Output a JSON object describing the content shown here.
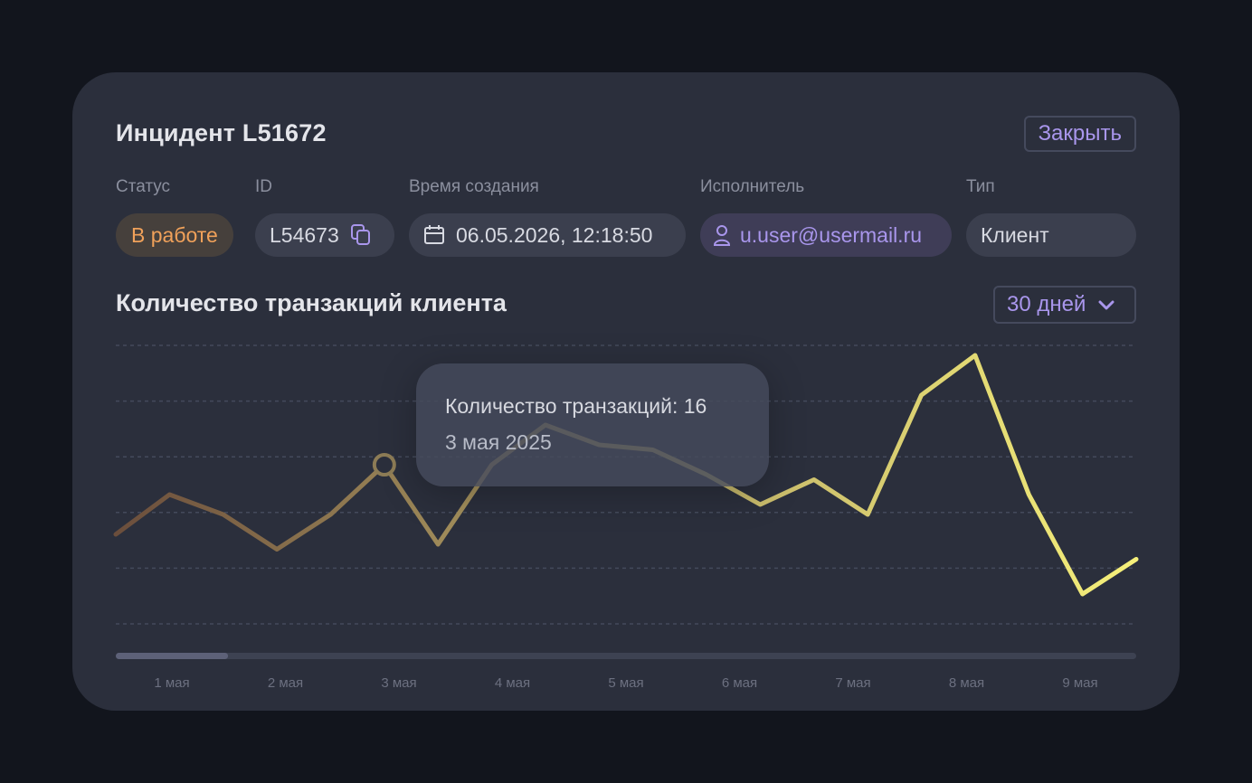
{
  "incident": {
    "title": "Инцидент L51672",
    "close_label": "Закрыть"
  },
  "fields": {
    "status": {
      "label": "Статус",
      "value": "В работе"
    },
    "id": {
      "label": "ID",
      "value": "L54673",
      "icon": "copy-icon"
    },
    "created": {
      "label": "Время создания",
      "value": "06.05.2026, 12:18:50",
      "icon": "calendar-icon"
    },
    "assignee": {
      "label": "Исполнитель",
      "value": "u.user@usermail.ru",
      "icon": "user-icon"
    },
    "type": {
      "label": "Тип",
      "value": "Клиент"
    }
  },
  "colors": {
    "accent": "#a996ec",
    "status_orange": "#f0a15a",
    "line_start": "#6b4e3c",
    "line_end": "#f6f07a"
  },
  "chart_section": {
    "title": "Количество транзакций клиента",
    "range_value": "30 дней",
    "range_icon": "chevron-down-icon"
  },
  "tooltip": {
    "line1": "Количество транзакций: 16",
    "line2": "3 мая 2025"
  },
  "scrollbar": {
    "visible_fraction": 0.11
  },
  "chart_data": {
    "type": "line",
    "x_labels": [
      "1 мая",
      "2 мая",
      "3 мая",
      "4 мая",
      "5 мая",
      "6 мая",
      "7 мая",
      "8 мая",
      "9 мая"
    ],
    "values": [
      9,
      13,
      11,
      7.5,
      11,
      16,
      8,
      16,
      20,
      18,
      17.5,
      15,
      12,
      14.5,
      11,
      23,
      27,
      13,
      3,
      6.5
    ],
    "ylim": [
      0,
      28
    ],
    "highlight_index": 5,
    "grid": true,
    "series": [
      {
        "values": [
          9,
          13,
          11,
          7.5,
          11,
          16,
          8,
          16,
          20,
          18,
          17.5,
          15,
          12,
          14.5,
          11,
          23,
          27,
          13,
          3,
          6.5
        ]
      }
    ]
  }
}
